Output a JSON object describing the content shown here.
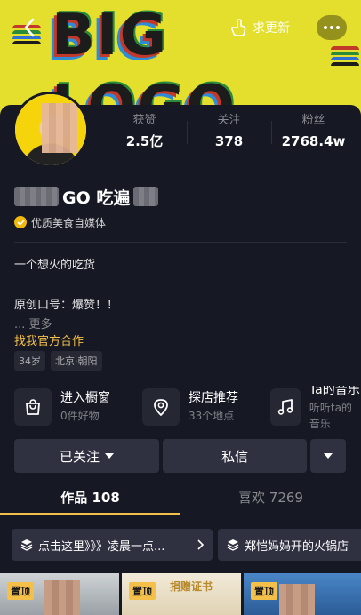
{
  "colors": {
    "banner_bg": "#e3df2c",
    "page_bg": "#161823",
    "accent": "#f5c04a",
    "verify_badge": "#f0b90b",
    "button_bg": "#2f3140"
  },
  "banner": {
    "logo_text": "BIG LOGO",
    "back_icon": "chevron-left-icon",
    "share_icon": "hand-pointer-icon",
    "share_label": "求更新",
    "more_icon": "ellipsis-icon"
  },
  "profile": {
    "name": "GO 吃遍",
    "verify_label": "优质美食自媒体",
    "bio_line1": "一个想火的吃货",
    "bio_line2": "原创口号：爆赞！！",
    "more_label": "... 更多",
    "cooperation_link": "找我官方合作",
    "tags": [
      "34岁",
      "北京·朝阳"
    ]
  },
  "stats": [
    {
      "label": "获赞",
      "value": "2.5亿"
    },
    {
      "label": "关注",
      "value": "378"
    },
    {
      "label": "粉丝",
      "value": "2768.4w"
    }
  ],
  "features": [
    {
      "title": "进入橱窗",
      "subtitle": "0件好物",
      "icon": "shopping-bag-icon"
    },
    {
      "title": "探店推荐",
      "subtitle": "33个地点",
      "icon": "location-pin-icon"
    },
    {
      "title": "Ta的音乐",
      "subtitle": "听听ta的音乐",
      "icon": "music-note-icon"
    }
  ],
  "actions": {
    "follow_label": "已关注",
    "message_label": "私信"
  },
  "tabs": [
    {
      "label": "作品 108",
      "active": true
    },
    {
      "label": "喜欢 7269",
      "active": false
    }
  ],
  "collections": [
    {
      "label": "点击这里》》》凌晨一点...",
      "icon": "layers-icon"
    },
    {
      "label": "郑恺妈妈开的火锅店",
      "icon": "layers-icon"
    }
  ],
  "thumbnails": [
    {
      "pin_label": "置顶"
    },
    {
      "pin_label": "置顶",
      "caption": "捐赠证书"
    },
    {
      "pin_label": "置顶"
    }
  ]
}
